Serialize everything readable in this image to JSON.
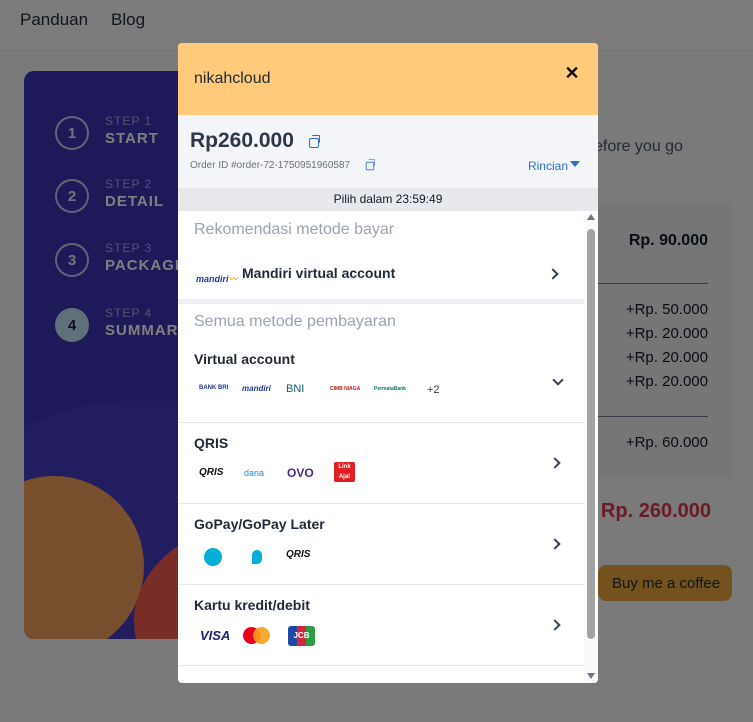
{
  "nav": {
    "links": [
      "Panduan",
      "Blog"
    ]
  },
  "wizard": {
    "steps": [
      {
        "num": "1",
        "caption": "STEP 1",
        "title": "START"
      },
      {
        "num": "2",
        "caption": "STEP 2",
        "title": "DETAIL"
      },
      {
        "num": "3",
        "caption": "STEP 3",
        "title": "PACKAGE"
      },
      {
        "num": "4",
        "caption": "STEP 4",
        "title": "SUMMAR"
      }
    ],
    "active_step": 4
  },
  "background": {
    "partial_text": "efore you go",
    "base_amount": "Rp. 90.000",
    "addons": [
      "+Rp. 50.000",
      "+Rp. 20.000",
      "+Rp. 20.000",
      "+Rp. 20.000"
    ],
    "extra": "+Rp. 60.000",
    "total": "Rp. 260.000",
    "coffee_button": "Buy me a coffee"
  },
  "modal": {
    "merchant": "nikahcloud",
    "close_symbol": "✕",
    "amount": "Rp260.000",
    "order_id": "Order ID #order-72-1750951960587",
    "details_link": "Rincian",
    "timer": "Pilih dalam 23:59:49",
    "recommended": {
      "title": "Rekomendasi metode bayar",
      "item": {
        "logo": "mandiri",
        "label": "Mandiri virtual account"
      }
    },
    "all_methods_title": "Semua metode pembayaran",
    "methods": [
      {
        "label": "Virtual account",
        "logos": [
          "BANK BRI",
          "mandiri",
          "BNI",
          "CIMB NIAGA",
          "PermataBank"
        ],
        "more": "+2",
        "expanded": true
      },
      {
        "label": "QRIS",
        "logos": [
          "QRIS",
          "dana",
          "OVO",
          "Link Aja!"
        ]
      },
      {
        "label": "GoPay/GoPay Later",
        "logos": [
          "gopay",
          "gopaylater",
          "QRIS"
        ]
      },
      {
        "label": "Kartu kredit/debit",
        "logos": [
          "VISA",
          "mastercard",
          "JCB"
        ]
      }
    ]
  },
  "colors": {
    "modal_header": "#ffcb7b",
    "link_blue": "#2c6fd1",
    "total_red": "#d93448",
    "wizard_bg": "#3d35b5",
    "coffee_button": "#e6a43c"
  }
}
